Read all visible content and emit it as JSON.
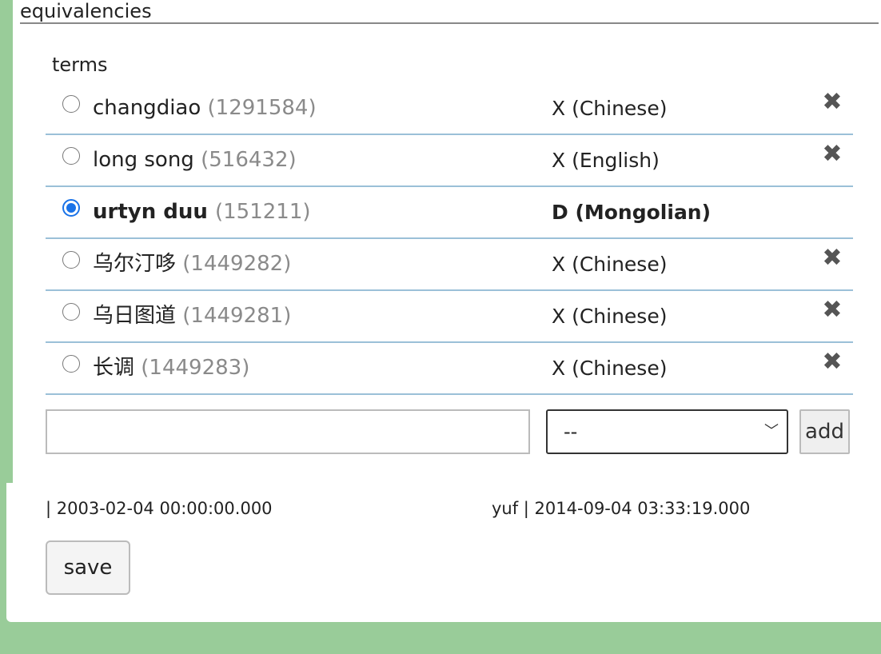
{
  "section": {
    "title": "equivalencies"
  },
  "terms": {
    "label": "terms",
    "rows": [
      {
        "name": "changdiao",
        "id": "(1291584)",
        "type": "X  (Chinese)",
        "selected": false,
        "bold": false,
        "deletable": true
      },
      {
        "name": "long song",
        "id": "(516432)",
        "type": "X  (English)",
        "selected": false,
        "bold": false,
        "deletable": true
      },
      {
        "name": "urtyn duu",
        "id": "(151211)",
        "type": "D  (Mongolian)",
        "selected": true,
        "bold": true,
        "deletable": false
      },
      {
        "name": "乌尔汀哆",
        "id": "(1449282)",
        "type": "X  (Chinese)",
        "selected": false,
        "bold": false,
        "deletable": true
      },
      {
        "name": "乌日图道",
        "id": "(1449281)",
        "type": "X  (Chinese)",
        "selected": false,
        "bold": false,
        "deletable": true
      },
      {
        "name": "长调",
        "id": "(1449283)",
        "type": "X  (Chinese)",
        "selected": false,
        "bold": false,
        "deletable": true
      }
    ],
    "delete_icon": "close-x-icon"
  },
  "add_form": {
    "input_value": "",
    "select_value": "--",
    "add_label": "add"
  },
  "meta": {
    "created": "| 2003-02-04 00:00:00.000",
    "updated": "yuf | 2014-09-04 03:33:19.000"
  },
  "save_label": "save",
  "colors": {
    "background": "#99cc99",
    "radio_accent": "#1a73e8",
    "row_divider": "#9bc0d8",
    "muted_id": "#8a8a8a"
  }
}
